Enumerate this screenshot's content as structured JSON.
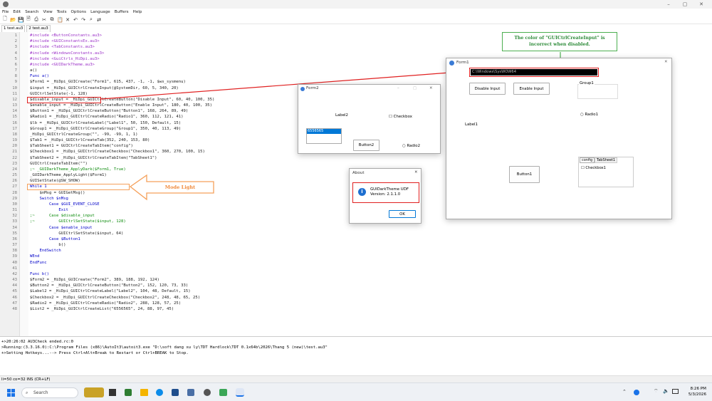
{
  "window": {
    "min_icon": "–",
    "max_icon": "▢",
    "close_icon": "✕"
  },
  "menu": [
    "File",
    "Edit",
    "Search",
    "View",
    "Tools",
    "Options",
    "Language",
    "Buffers",
    "Help"
  ],
  "tabs": [
    "1 test.au3",
    "2 test.au3"
  ],
  "code": [
    "#include <ButtonConstants.au3>",
    "#include <GUIConstantsEx.au3>",
    "#include <TabConstants.au3>",
    "#include <WindowsConstants.au3>",
    "#include <GuiCtrls_HiDpi.au3>",
    "#include <GUIDarkTheme.au3>",
    "a()",
    "Func a()",
    "$Form1 = _HiDpi_GUICreate(\"Form1\", 615, 437, -1, -1, $ws_sysmenu)",
    "$input = _HiDpi_GUICtrlCreateInput(@SystemDir, 60, 5, 340, 20)",
    "GUICtrlSetState(-1, 128)",
    "$disable_input = _HiDpi_GUICtrlCreateButton(\"Disable Input\", 60, 40, 100, 35)",
    "$enable_input = _HiDpi_GUICtrlCreateButton(\"Enable Input\", 180, 40, 100, 35)",
    "$Button1 = _HiDpi_GUICtrlCreateButton(\"Button1\", 168, 264, 89, 49)",
    "$Radio1 = _HiDpi_GUICtrlCreateRadio(\"Radio1\", 360, 112, 121, 41)",
    "$lb = _HiDpi_GUICtrlCreateLabel(\"Label1\", 50, 150, Default, 15)",
    "$Group1 = _HiDpi_GUICtrlCreateGroup(\"Group1\", 350, 40, 113, 49)",
    "_HiDpi_GUICtrlCreateGroup(\"\", -99, -99, 1, 1)",
    "$Tab1 = _HiDpi_GUICtrlCreateTab(352, 240, 153, 80)",
    "$TabSheet1 = GUICtrlCreateTabItem(\"config\")",
    "$Checkbox1 = _HiDpi_GUICtrlCreateCheckbox(\"Checkbox1\", 360, 270, 100, 15)",
    "$TabSheet2 = _HiDpi_GUICtrlCreateTabItem(\"TabSheet1\")",
    "GUICtrlCreateTabItem(\"\")",
    ";~ _GUIDarkTheme_ApplyDark($Form1, True)",
    "_GUIDarkTheme_ApplyLight($Form1)",
    "GUISetState(@SW_SHOW)",
    "While 1",
    "    $nMsg = GUIGetMsg()",
    "    Switch $nMsg",
    "        Case $GUI_EVENT_CLOSE",
    "            Exit",
    ";~      Case $disable_input",
    ";~          GUICtrlSetState($input, 128)",
    "        Case $enable_input",
    "            GUICtrlSetState($input, 64)",
    "        Case $Button1",
    "            b()",
    "    EndSwitch",
    "WEnd",
    "EndFunc",
    "",
    "Func b()",
    "$Form2 = _HiDpi_GUICreate(\"Form2\", 389, 188, 192, 124)",
    "$Button2 = _HiDpi_GUICtrlCreateButton(\"Button2\", 152, 120, 73, 33)",
    "$Label2 = _HiDpi_GUICtrlCreateLabel(\"Label2\", 104, 48, Default, 15)",
    "$Checkbox2 = _HiDpi_GUICtrlCreateCheckbox(\"Checkbox2\", 248, 48, 65, 25)",
    "$Radio2 = _HiDpi_GUICtrlCreateRadio(\"Radio2\", 288, 128, 57, 25)",
    "$List2 = _HiDpi_GUICtrlCreateList(\"6556565\", 24, 88, 97, 45)"
  ],
  "output": [
    "+>20:26:02 AU3Check ended.rc:0",
    ">Running:(3.3.16.0):C:\\Program Files (x86)\\AutoIt3\\autoit3.exe \"D:\\soft dang xu ly\\TDT Hardlock\\TDT 0.1x64b\\2026\\Thang 5 (new)\\test.au3\"",
    "+>Setting Hotkeys...--> Press Ctrl+Alt+Break to Restart or Ctrl+BREAK to Stop."
  ],
  "status": "li=50 co=32 INS (CR+LF)",
  "annotations": {
    "input_note": "The color of \"GUICtrlCreateInput\" is incorrect when disabled.",
    "mode_light": "Mode Light"
  },
  "form1": {
    "title": "Form1",
    "input_value": "C:\\Windows\\SysWOW64",
    "disable_btn": "Disable Input",
    "enable_btn": "Enable Input",
    "group": "Group1",
    "radio": "Radio1",
    "label": "Label1",
    "button1": "Button1",
    "tab1": "config",
    "tab2": "TabSheet1",
    "checkbox": "Checkbox1"
  },
  "form2": {
    "title": "Form2",
    "label": "Label2",
    "checkbox": "Checkbox",
    "list_item": "6556565",
    "button": "Button2",
    "radio": "Radio2"
  },
  "about": {
    "title": "About",
    "line1": "GUIDarkTheme UDF",
    "line2": "Version:  2.1.1.0",
    "ok": "OK"
  },
  "taskbar": {
    "search": "Search",
    "time": "8:26 PM",
    "date": "5/3/2026"
  },
  "colors": {
    "highlight": "#e02020",
    "annot_green": "#4caf50",
    "annot_orange": "#f5a05a"
  }
}
